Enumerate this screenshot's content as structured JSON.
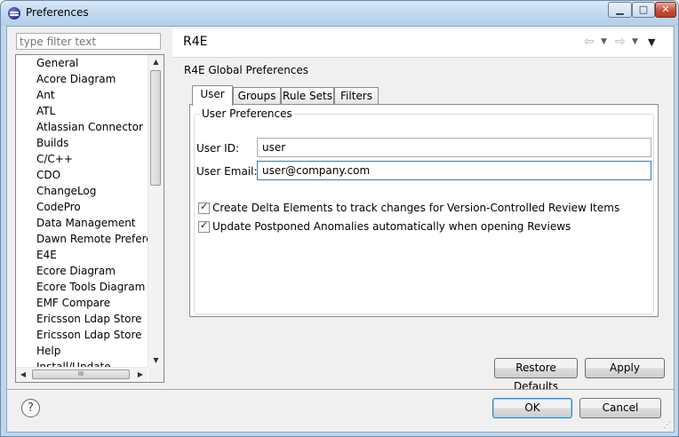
{
  "window": {
    "title": "Preferences"
  },
  "window_controls": {
    "minimize": "▁",
    "maximize": "□",
    "close": "✕"
  },
  "filter": {
    "placeholder": "type filter text"
  },
  "tree": {
    "items": [
      "General",
      "Acore Diagram",
      "Ant",
      "ATL",
      "Atlassian Connector",
      "Builds",
      "C/C++",
      "CDO",
      "ChangeLog",
      "CodePro",
      "Data Management",
      "Dawn Remote Preferences",
      "E4E",
      "Ecore Diagram",
      "Ecore Tools Diagram",
      "EMF Compare",
      "Ericsson Ldap Store",
      "Ericsson Ldap Store",
      "Help",
      "Install/Update"
    ],
    "hscroll_grip": "III"
  },
  "page": {
    "title": "R4E",
    "section_label": "R4E Global Preferences",
    "tabs": [
      "User",
      "Groups",
      "Rule Sets",
      "Filters"
    ],
    "group_title": "User Preferences",
    "user_id_label": "User ID:",
    "user_id_value": "user",
    "user_email_label": "User Email:",
    "user_email_value": "user@company.com",
    "checkbox_delta_label": "Create Delta Elements to track changes for Version-Controlled Review Items",
    "checkbox_delta_checked": true,
    "checkbox_postponed_label": "Update Postponed Anomalies automatically when opening Reviews",
    "checkbox_postponed_checked": true
  },
  "buttons": {
    "restore_defaults": "Restore Defaults",
    "apply": "Apply",
    "ok": "OK",
    "cancel": "Cancel"
  },
  "icons": {
    "back": "⇦",
    "forward": "⇨",
    "dropdown": "▼",
    "check": "✓",
    "help": "?"
  }
}
